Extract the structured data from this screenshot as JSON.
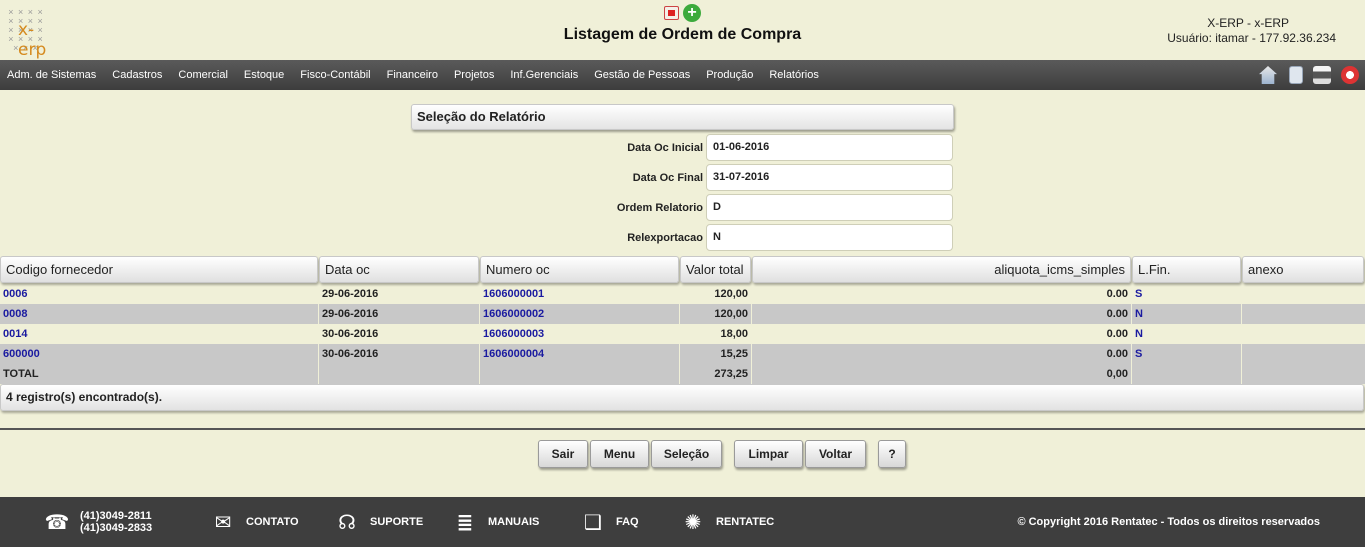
{
  "header": {
    "logo_text": "x-erp",
    "page_title": "Listagem de Ordem de Compra",
    "app_name": "X-ERP - x-ERP",
    "user_info": "Usuário: itamar - 177.92.36.234",
    "icons": [
      "pdf-icon",
      "add-icon"
    ]
  },
  "menu": {
    "items": [
      "Adm. de Sistemas",
      "Cadastros",
      "Comercial",
      "Estoque",
      "Fisco-Contábil",
      "Financeiro",
      "Projetos",
      "Inf.Gerenciais",
      "Gestão de Pessoas",
      "Produção",
      "Relatórios"
    ],
    "icons": [
      "home-icon",
      "document-icon",
      "print-icon",
      "power-icon"
    ]
  },
  "selection": {
    "title": "Seleção do Relatório",
    "fields": [
      {
        "label": "Data Oc Inicial",
        "value": "01-06-2016"
      },
      {
        "label": "Data Oc Final",
        "value": "31-07-2016"
      },
      {
        "label": "Ordem Relatorio",
        "value": "D"
      },
      {
        "label": "Relexportacao",
        "value": "N"
      }
    ]
  },
  "table": {
    "columns": [
      "Codigo fornecedor",
      "Data oc",
      "Numero oc",
      "Valor total",
      "aliquota_icms_simples",
      "L.Fin.",
      "anexo"
    ],
    "rows": [
      {
        "codigo": "0006",
        "data": "29-06-2016",
        "numero": "1606000001",
        "valor": "120,00",
        "aliquota": "0.00",
        "lfin": "S",
        "anexo": ""
      },
      {
        "codigo": "0008",
        "data": "29-06-2016",
        "numero": "1606000002",
        "valor": "120,00",
        "aliquota": "0.00",
        "lfin": "N",
        "anexo": ""
      },
      {
        "codigo": "0014",
        "data": "30-06-2016",
        "numero": "1606000003",
        "valor": "18,00",
        "aliquota": "0.00",
        "lfin": "N",
        "anexo": ""
      },
      {
        "codigo": "600000",
        "data": "30-06-2016",
        "numero": "1606000004",
        "valor": "15,25",
        "aliquota": "0.00",
        "lfin": "S",
        "anexo": ""
      }
    ],
    "total": {
      "label": "TOTAL",
      "valor": "273,25",
      "aliquota": "0,00"
    },
    "status": "4 registro(s) encontrado(s)."
  },
  "buttons": {
    "sair": "Sair",
    "menu": "Menu",
    "selecao": "Seleção",
    "limpar": "Limpar",
    "voltar": "Voltar",
    "help": "?"
  },
  "footer": {
    "phone1": "(41)3049-2811",
    "phone2": "(41)3049-2833",
    "contato": "CONTATO",
    "suporte": "SUPORTE",
    "manuais": "MANUAIS",
    "faq": "FAQ",
    "rentatec": "RENTATEC",
    "copyright": "© Copyright 2016 Rentatec - Todos os direitos reservados",
    "icons": [
      "phone-icon",
      "mail-icon",
      "headset-icon",
      "books-icon",
      "faq-icon",
      "rentatec-icon"
    ]
  },
  "colors": {
    "background": "#f0f0d8",
    "menubar": "#3d3d3d",
    "link": "#1a1aa0",
    "logo": "#d58a1e",
    "row_alt": "#c8c8c8"
  }
}
